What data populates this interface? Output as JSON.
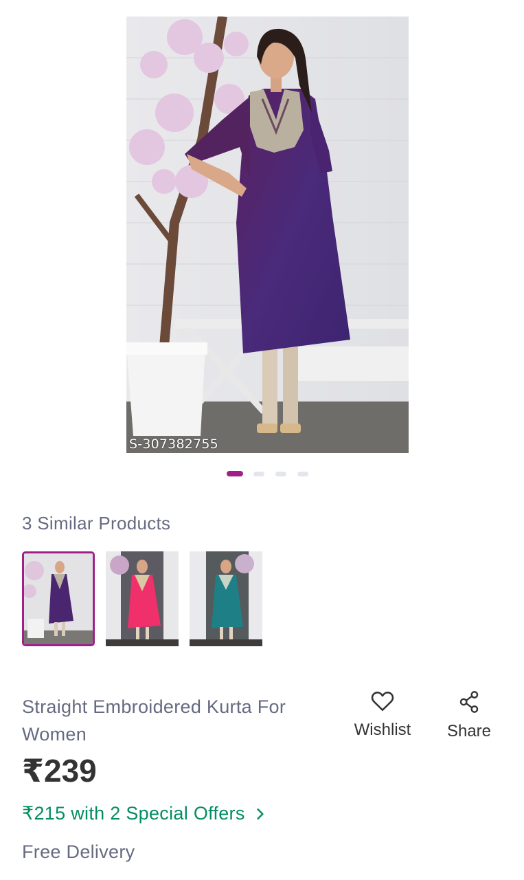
{
  "product_image": {
    "sku_text": "S-307382755"
  },
  "carousel": {
    "active_index": 0,
    "count": 4,
    "active_color": "#9f2089"
  },
  "similar": {
    "title": "3 Similar Products",
    "items": [
      {
        "color": "purple",
        "selected": true
      },
      {
        "color": "pink",
        "selected": false
      },
      {
        "color": "teal",
        "selected": false
      }
    ]
  },
  "product": {
    "title": "Straight Embroidered Kurta For Women",
    "price": "₹239",
    "offers_text": "₹215 with 2 Special Offers",
    "delivery": "Free Delivery"
  },
  "actions": {
    "wishlist_label": "Wishlist",
    "wishlist_icon": "heart-icon",
    "share_label": "Share",
    "share_icon": "share-icon"
  },
  "colors": {
    "brand": "#9f2089",
    "offer_green": "#038d63",
    "muted_text": "#666a80",
    "dark_text": "#333333"
  }
}
